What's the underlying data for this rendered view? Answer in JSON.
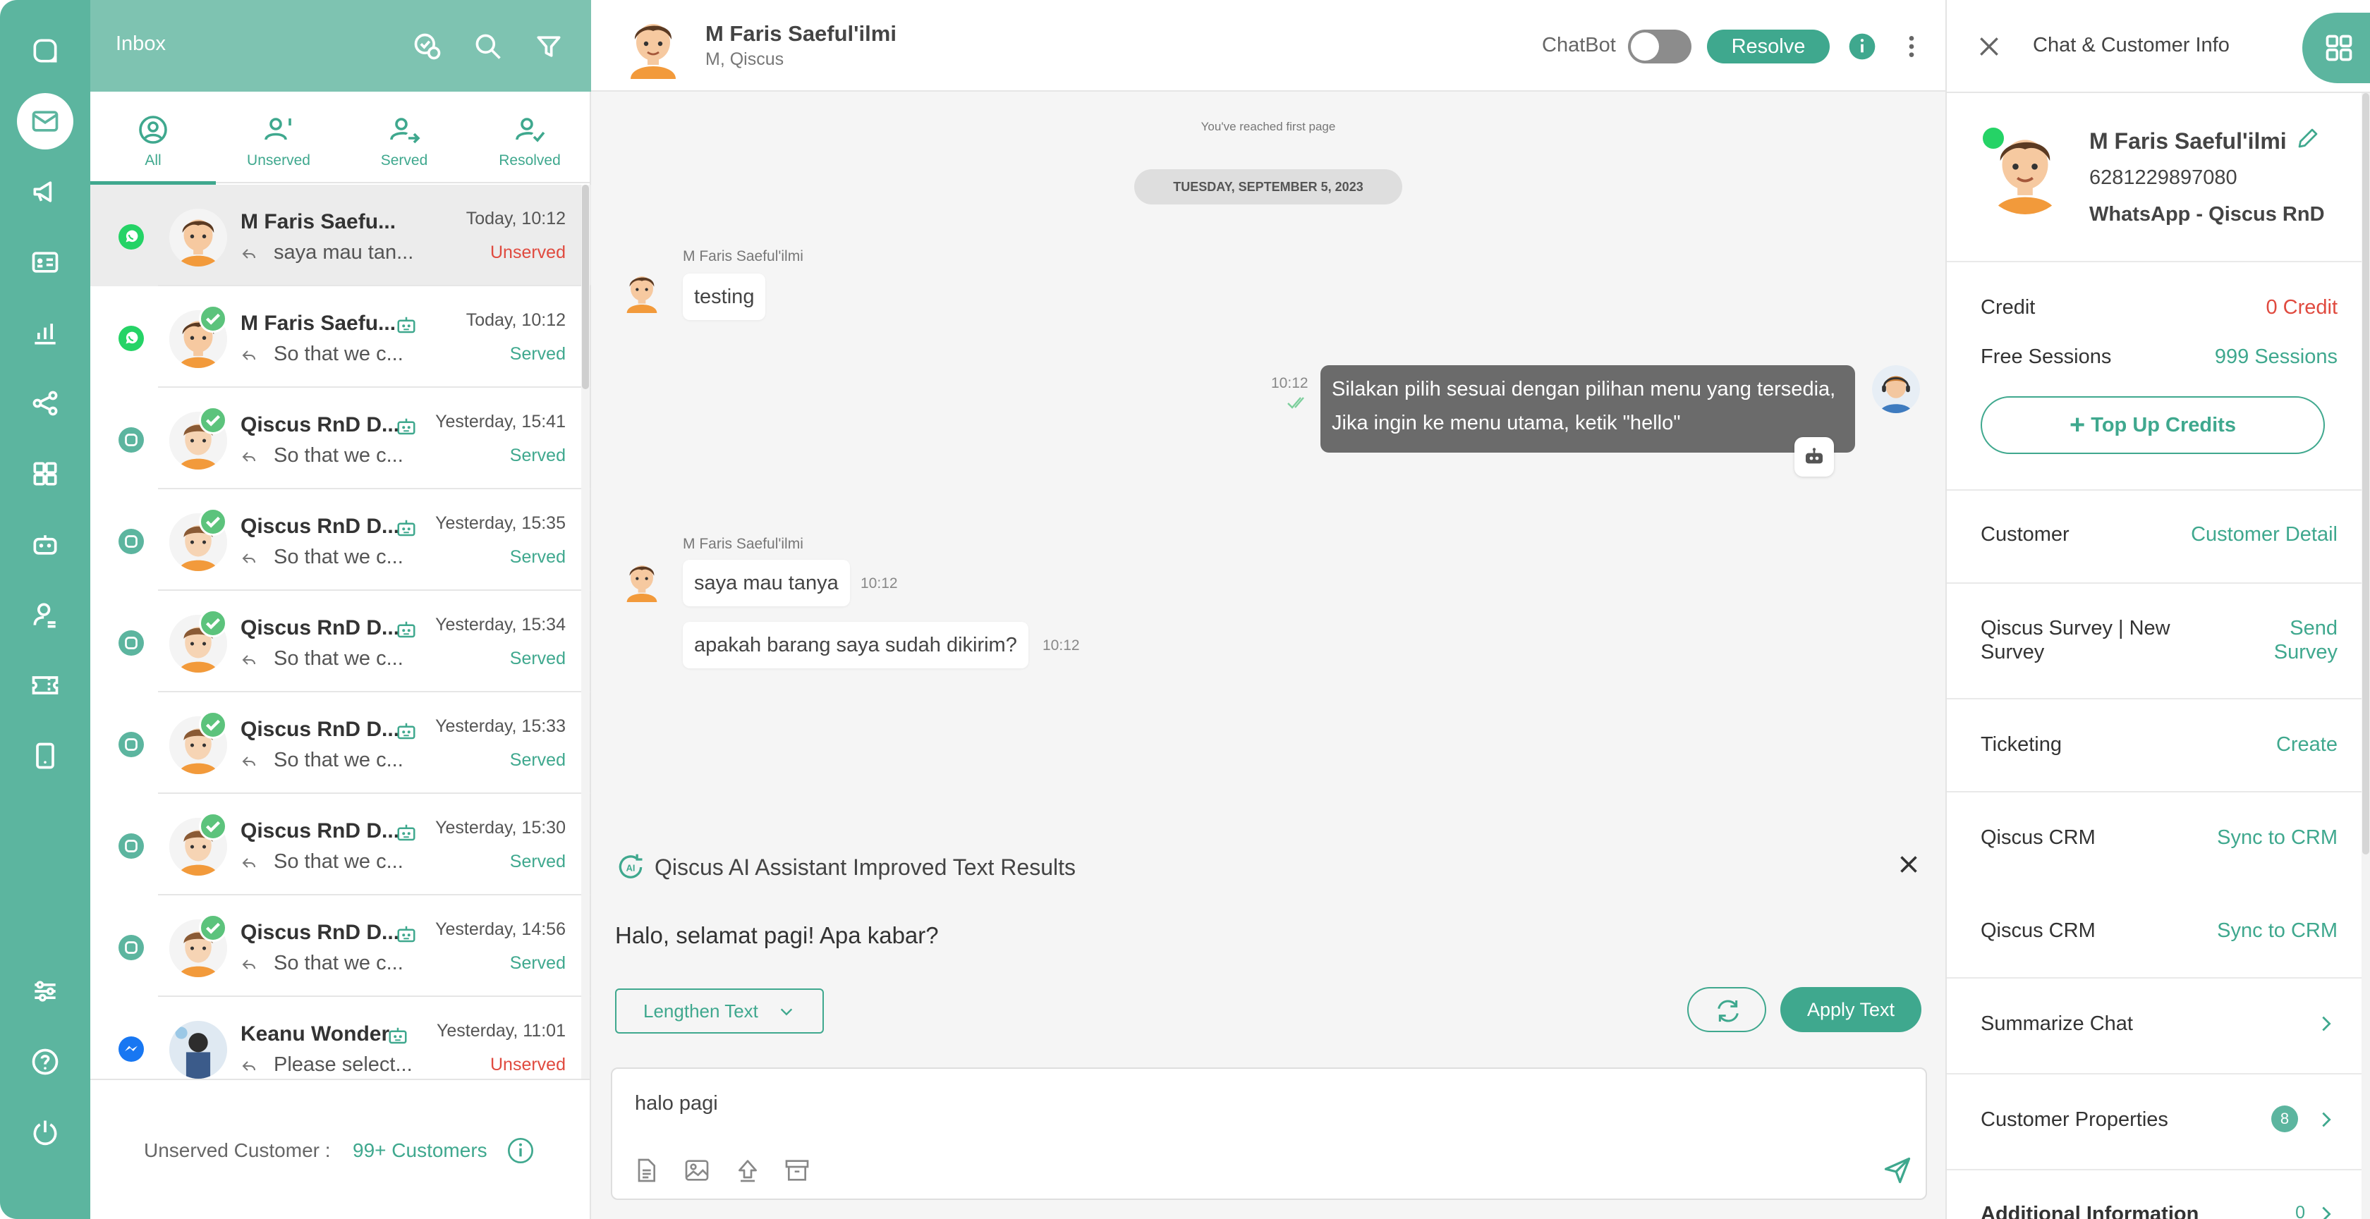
{
  "colors": {
    "accent": "#3fa88e",
    "rail": "#5cb59f",
    "header": "#7ec3b1",
    "danger": "#e04a3f",
    "bubble_out": "#6b6b6b"
  },
  "rail": {
    "icons": [
      "chat-logo-icon",
      "inbox-icon",
      "megaphone-icon",
      "contact-card-icon",
      "analytics-icon",
      "integration-icon",
      "apps-icon",
      "bot-icon",
      "agent-icon",
      "ticket-icon",
      "mobile-icon",
      "settings-sliders-icon",
      "help-icon",
      "power-icon"
    ]
  },
  "inbox": {
    "title": "Inbox",
    "tabs": [
      {
        "label": "All"
      },
      {
        "label": "Unserved"
      },
      {
        "label": "Served"
      },
      {
        "label": "Resolved"
      }
    ],
    "conversations": [
      {
        "name": "M Faris Saefu...",
        "time": "Today, 10:12",
        "preview": "saya mau tan...",
        "status": "Unserved",
        "channel": "whatsapp",
        "bot": false,
        "checked": false
      },
      {
        "name": "M Faris Saefu...",
        "time": "Today, 10:12",
        "preview": "So that we c...",
        "status": "Served",
        "channel": "whatsapp",
        "bot": true,
        "checked": true
      },
      {
        "name": "Qiscus RnD D...",
        "time": "Yesterday, 15:41",
        "preview": "So that we c...",
        "status": "Served",
        "channel": "qiscus",
        "bot": true,
        "checked": true
      },
      {
        "name": "Qiscus RnD D...",
        "time": "Yesterday, 15:35",
        "preview": "So that we c...",
        "status": "Served",
        "channel": "qiscus",
        "bot": true,
        "checked": true
      },
      {
        "name": "Qiscus RnD D...",
        "time": "Yesterday, 15:34",
        "preview": "So that we c...",
        "status": "Served",
        "channel": "qiscus",
        "bot": true,
        "checked": true
      },
      {
        "name": "Qiscus RnD D...",
        "time": "Yesterday, 15:33",
        "preview": "So that we c...",
        "status": "Served",
        "channel": "qiscus",
        "bot": true,
        "checked": true
      },
      {
        "name": "Qiscus RnD D...",
        "time": "Yesterday, 15:30",
        "preview": "So that we c...",
        "status": "Served",
        "channel": "qiscus",
        "bot": true,
        "checked": true
      },
      {
        "name": "Qiscus RnD D...",
        "time": "Yesterday, 14:56",
        "preview": "So that we c...",
        "status": "Served",
        "channel": "qiscus",
        "bot": true,
        "checked": true
      },
      {
        "name": "Keanu Wonder",
        "time": "Yesterday, 11:01",
        "preview": "Please select...",
        "status": "Unserved",
        "channel": "messenger",
        "bot": true,
        "checked": false
      }
    ],
    "unserved_label": "Unserved Customer :",
    "unserved_count": "99+ Customers"
  },
  "chat": {
    "name": "M Faris Saeful'ilmi",
    "subtitle": "M, Qiscus",
    "chatbot_label": "ChatBot",
    "resolve_label": "Resolve",
    "first_page": "You've reached first page",
    "date": "TUESDAY, SEPTEMBER 5, 2023",
    "messages": {
      "m1_sender": "M Faris Saeful'ilmi",
      "m1_text": "testing",
      "bot_time": "10:12",
      "bot_line1": "Silakan pilih sesuai dengan pilihan menu yang tersedia,",
      "bot_line2": "Jika ingin ke menu utama, ketik \"hello\"",
      "m2_sender": "M Faris Saeful'ilmi",
      "m2_text": "saya mau tanya",
      "m2_time": "10:12",
      "m3_text": "apakah barang saya sudah dikirim?",
      "m3_time": "10:12"
    },
    "ai": {
      "title": "Qiscus AI Assistant Improved Text Results",
      "result": "Halo, selamat pagi! Apa kabar?",
      "mode_label": "Lengthen Text",
      "apply_label": "Apply Text"
    },
    "composer_value": "halo pagi"
  },
  "info": {
    "title": "Chat & Customer Info",
    "customer_name": "M Faris Saeful'ilmi",
    "phone": "6281229897080",
    "channel": "WhatsApp - Qiscus RnD",
    "credit_label": "Credit",
    "credit_value": "0 Credit",
    "sessions_label": "Free Sessions",
    "sessions_value": "999 Sessions",
    "topup_label": "Top Up Credits",
    "customer_label": "Customer",
    "customer_link": "Customer Detail",
    "survey_label_1": "Qiscus Survey | New",
    "survey_label_2": "Survey",
    "survey_link_1": "Send",
    "survey_link_2": "Survey",
    "ticketing_label": "Ticketing",
    "ticketing_link": "Create",
    "crm1_label": "Qiscus CRM",
    "crm1_link": "Sync to CRM",
    "crm2_label": "Qiscus CRM",
    "crm2_link": "Sync to CRM",
    "summarize_label": "Summarize Chat",
    "properties_label": "Customer Properties",
    "properties_count": "8",
    "additional_label": "Additional Information",
    "additional_count": "0"
  }
}
